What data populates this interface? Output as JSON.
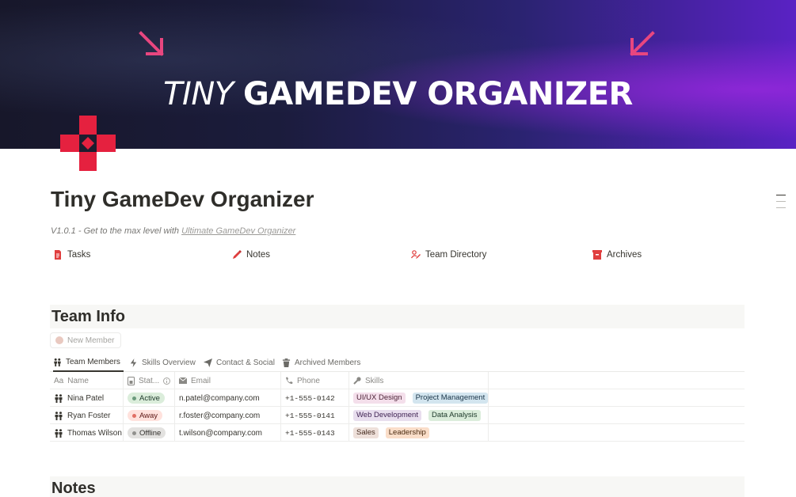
{
  "cover": {
    "title_thin": "TINY",
    "title_bold": "GAMEDEV ORGANIZER",
    "accent_color": "#e8467f"
  },
  "page": {
    "icon": "red-dpad-icon",
    "title": "Tiny GameDev Organizer",
    "subtitle_prefix": "V1.0.1 - Get to the max level with ",
    "subtitle_link": "Ultimate GameDev Organizer"
  },
  "quick_links": [
    {
      "label": "Tasks",
      "icon": "document-icon",
      "color": "#e03e3e"
    },
    {
      "label": "Notes",
      "icon": "pencil-icon",
      "color": "#e03e3e"
    },
    {
      "label": "Team Directory",
      "icon": "people-edit-icon",
      "color": "#e03e3e"
    },
    {
      "label": "Archives",
      "icon": "archive-box-icon",
      "color": "#e03e3e"
    }
  ],
  "team_info": {
    "heading": "Team Info",
    "new_button": "New Member",
    "views": [
      {
        "label": "Team Members",
        "icon": "people-icon",
        "active": true
      },
      {
        "label": "Skills Overview",
        "icon": "lightning-icon",
        "active": false
      },
      {
        "label": "Contact & Social",
        "icon": "send-icon",
        "active": false
      },
      {
        "label": "Archived Members",
        "icon": "trash-icon",
        "active": false
      }
    ],
    "columns": {
      "name": "Name",
      "status": "Stat...",
      "email": "Email",
      "phone": "Phone",
      "skills": "Skills"
    },
    "column_icons": {
      "name": "Aa",
      "status": "status-icon",
      "email": "mail-icon",
      "phone": "phone-icon",
      "skills": "wrench-icon"
    },
    "rows": [
      {
        "name": "Nina Patel",
        "status": "Active",
        "status_bg": "#dbeddb",
        "status_fg": "#1c3829",
        "status_dot": "#6c9b7d",
        "email": "n.patel@company.com",
        "phone": "+1-555-0142",
        "skills": [
          {
            "label": "UI/UX Design",
            "bg": "#f4dfeb",
            "fg": "#4c2337"
          },
          {
            "label": "Project Management",
            "bg": "#d3e5ef",
            "fg": "#183347"
          }
        ]
      },
      {
        "name": "Ryan Foster",
        "status": "Away",
        "status_bg": "#ffe2dd",
        "status_fg": "#5d1715",
        "status_dot": "#e16f64",
        "email": "r.foster@company.com",
        "phone": "+1-555-0141",
        "skills": [
          {
            "label": "Web Development",
            "bg": "#e8deee",
            "fg": "#412454"
          },
          {
            "label": "Data Analysis",
            "bg": "#dbeddb",
            "fg": "#1c3829"
          }
        ]
      },
      {
        "name": "Thomas Wilson",
        "status": "Offline",
        "status_bg": "#e3e2e0",
        "status_fg": "#32302c",
        "status_dot": "#91918e",
        "email": "t.wilson@company.com",
        "phone": "+1-555-0143",
        "skills": [
          {
            "label": "Sales",
            "bg": "#eee0da",
            "fg": "#442a1e"
          },
          {
            "label": "Leadership",
            "bg": "#fadec9",
            "fg": "#49290e"
          }
        ]
      }
    ]
  },
  "notes": {
    "heading": "Notes"
  }
}
